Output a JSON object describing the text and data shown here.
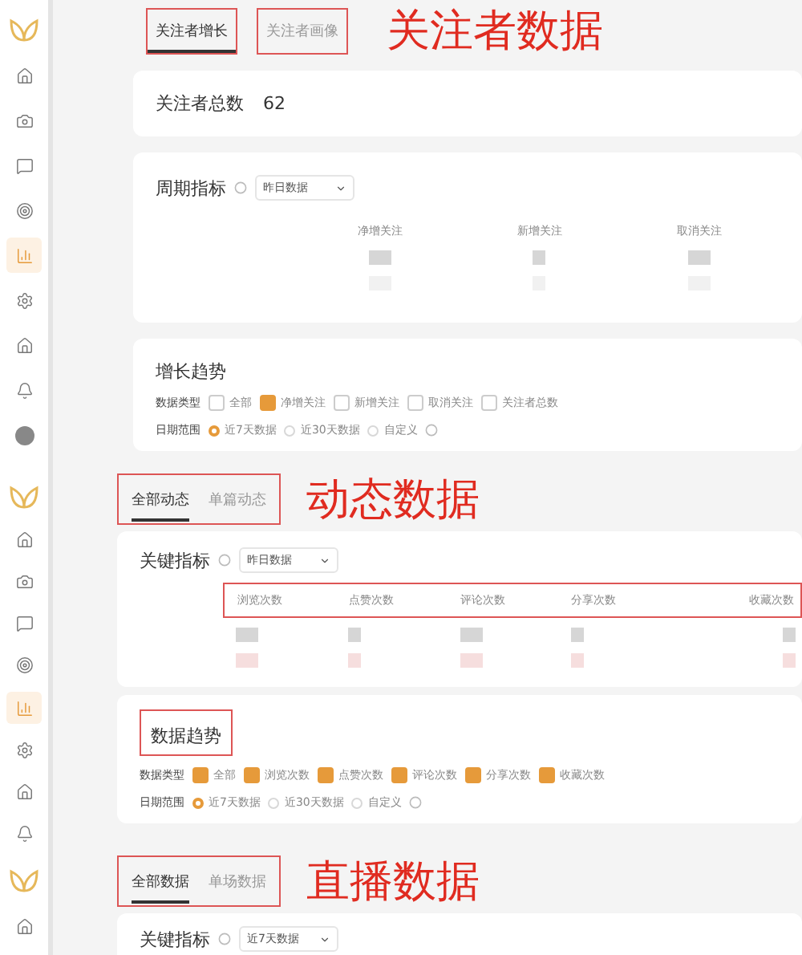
{
  "panels": [
    {
      "kind": "follower",
      "annotation": "关注者数据",
      "sidebar": [
        {
          "kind": "logo",
          "selected": false
        },
        {
          "kind": "home",
          "selected": false
        },
        {
          "kind": "camera",
          "selected": false
        },
        {
          "kind": "message",
          "selected": false
        },
        {
          "kind": "target",
          "selected": false
        },
        {
          "kind": "chart",
          "selected": true
        },
        {
          "kind": "gear",
          "selected": false
        },
        {
          "kind": "house",
          "selected": false
        },
        {
          "kind": "bell",
          "selected": false
        },
        {
          "kind": "avatar",
          "selected": false
        }
      ],
      "tabs": [
        {
          "label": "关注者增长",
          "selected": true,
          "boxed": true
        },
        {
          "label": "关注者画像",
          "selected": false,
          "boxed": true
        }
      ],
      "total": {
        "label": "关注者总数",
        "value": "62"
      },
      "period": {
        "title": "周期指标",
        "select": "昨日数据",
        "metrics": [
          "净增关注",
          "新增关注",
          "取消关注"
        ]
      },
      "trend": {
        "title": "增长趋势",
        "type_label": "数据类型",
        "types": [
          {
            "label": "全部",
            "checked": false
          },
          {
            "label": "净增关注",
            "checked": true
          },
          {
            "label": "新增关注",
            "checked": false
          },
          {
            "label": "取消关注",
            "checked": false
          },
          {
            "label": "关注者总数",
            "checked": false
          }
        ],
        "range_label": "日期范围",
        "ranges": [
          {
            "label": "近7天数据",
            "selected": true
          },
          {
            "label": "近30天数据",
            "selected": false
          },
          {
            "label": "自定义",
            "selected": false
          }
        ]
      }
    },
    {
      "kind": "posts",
      "annotation": "动态数据",
      "sidebar": [
        {
          "kind": "logo",
          "selected": false
        },
        {
          "kind": "home",
          "selected": false
        },
        {
          "kind": "camera",
          "selected": false
        },
        {
          "kind": "message",
          "selected": false
        },
        {
          "kind": "target",
          "selected": false
        },
        {
          "kind": "chart",
          "selected": true
        },
        {
          "kind": "gear",
          "selected": false
        },
        {
          "kind": "house",
          "selected": false
        },
        {
          "kind": "bell",
          "selected": false
        }
      ],
      "tabs": [
        {
          "label": "全部动态",
          "selected": true,
          "boxed": false
        },
        {
          "label": "单篇动态",
          "selected": false,
          "boxed": false
        }
      ],
      "key": {
        "title": "关键指标",
        "select": "昨日数据",
        "metrics": [
          "浏览次数",
          "点赞次数",
          "评论次数",
          "分享次数",
          "收藏次数"
        ]
      },
      "trend": {
        "title": "数据趋势",
        "type_label": "数据类型",
        "types": [
          {
            "label": "全部",
            "checked": true
          },
          {
            "label": "浏览次数",
            "checked": true
          },
          {
            "label": "点赞次数",
            "checked": true
          },
          {
            "label": "评论次数",
            "checked": true
          },
          {
            "label": "分享次数",
            "checked": true
          },
          {
            "label": "收藏次数",
            "checked": true
          }
        ],
        "range_label": "日期范围",
        "ranges": [
          {
            "label": "近7天数据",
            "selected": true
          },
          {
            "label": "近30天数据",
            "selected": false
          },
          {
            "label": "自定义",
            "selected": false
          }
        ]
      }
    },
    {
      "kind": "live",
      "annotation": "直播数据",
      "sidebar": [
        {
          "kind": "logo",
          "selected": false
        },
        {
          "kind": "home",
          "selected": false
        }
      ],
      "tabs": [
        {
          "label": "全部数据",
          "selected": true,
          "boxed": false
        },
        {
          "label": "单场数据",
          "selected": false,
          "boxed": false
        }
      ],
      "key": {
        "title": "关键指标",
        "select": "近7天数据"
      }
    }
  ]
}
